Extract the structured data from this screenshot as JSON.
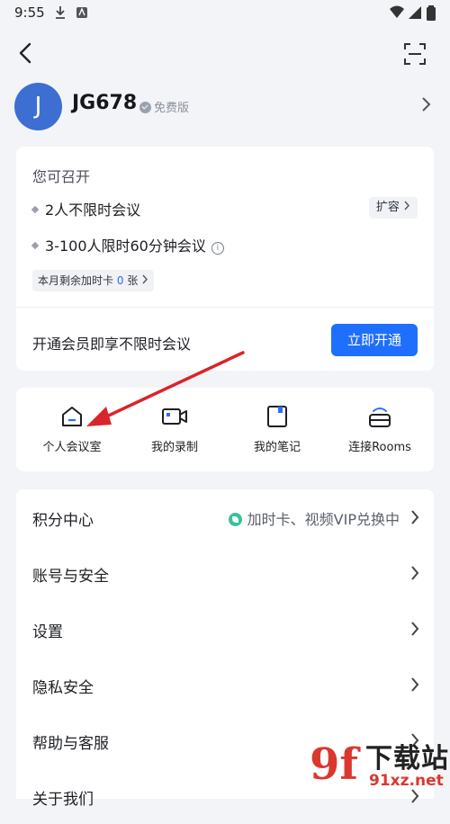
{
  "status_bar": {
    "time": "9:55"
  },
  "profile": {
    "initial": "J",
    "username": "JG678",
    "plan": "免费版"
  },
  "capacity_card": {
    "title": "您可召开",
    "features": [
      "2人不限时会议",
      "3-100人限时60分钟会议"
    ],
    "expand_label": "扩容",
    "card_prefix": "本月剩余加时卡",
    "card_count": "0",
    "card_unit": "张",
    "promo_text": "开通会员即享不限时会议",
    "open_button": "立即开通"
  },
  "quick_actions": [
    {
      "label": "个人会议室",
      "icon": "meeting-room-icon"
    },
    {
      "label": "我的录制",
      "icon": "recording-icon"
    },
    {
      "label": "我的笔记",
      "icon": "notes-icon"
    },
    {
      "label": "连接Rooms",
      "icon": "rooms-icon"
    }
  ],
  "menu": [
    {
      "label": "积分中心",
      "sub": "加时卡、视频VIP兑换中"
    },
    {
      "label": "账号与安全"
    },
    {
      "label": "设置"
    },
    {
      "label": "隐私安全"
    },
    {
      "label": "帮助与客服"
    },
    {
      "label": "关于我们"
    }
  ],
  "watermark": {
    "logo": "9f",
    "text": "下载站",
    "url": "91xz.net"
  },
  "colors": {
    "accent": "#1f6fff",
    "avatar": "#3d6fd3",
    "annotation_arrow": "#d9252a"
  }
}
